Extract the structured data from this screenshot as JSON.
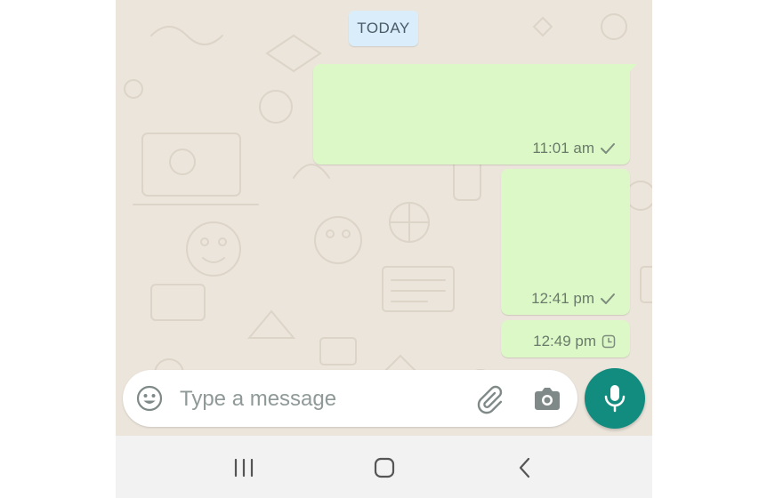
{
  "chat": {
    "date_label": "TODAY",
    "messages": [
      {
        "time": "11:01 am",
        "status": "sent"
      },
      {
        "time": "12:41 pm",
        "status": "sent"
      },
      {
        "time": "12:49 pm",
        "status": "pending"
      }
    ]
  },
  "composer": {
    "placeholder": "Type a message",
    "value": "",
    "icons": [
      "emoji-icon",
      "attach-icon",
      "camera-icon",
      "mic-icon"
    ]
  },
  "navbar": {
    "icons": [
      "recent-apps-icon",
      "home-icon",
      "back-icon"
    ]
  },
  "colors": {
    "wallpaper": "#ece5dc",
    "outgoing_bubble": "#dcf8c6",
    "date_pill": "#d9eefa",
    "accent": "#128c7e",
    "navbar": "#f2f2f2"
  }
}
